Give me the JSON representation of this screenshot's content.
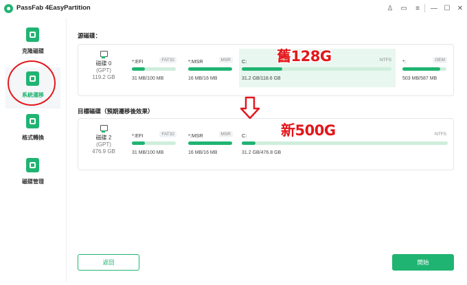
{
  "app": {
    "title": "PassFab 4EasyPartition"
  },
  "window_controls": {
    "user": "♙",
    "chat": "▭",
    "menu": "≡",
    "minimize": "—",
    "maximize": "☐",
    "close": "✕"
  },
  "sidebar": {
    "items": [
      {
        "label": "克隆磁碟",
        "icon": "clone-disk-icon"
      },
      {
        "label": "系統遷移",
        "icon": "system-migration-icon"
      },
      {
        "label": "格式轉換",
        "icon": "format-convert-icon"
      },
      {
        "label": "磁碟管理",
        "icon": "disk-management-icon"
      }
    ]
  },
  "source": {
    "label": "源磁碟：",
    "disk": {
      "name": "磁碟 0",
      "type": "(GPT)",
      "size": "119.2 GB"
    },
    "partitions": [
      {
        "name": "*:EFI",
        "fs": "FAT32",
        "size": "31 MB/100 MB",
        "fill": 0.3
      },
      {
        "name": "*:MSR",
        "fs": "MSR",
        "size": "16 MB/16 MB",
        "fill": 1.0
      },
      {
        "name": "C:",
        "fs": "NTFS",
        "size": "31.2 GB/118.6 GB",
        "fill": 0.27
      },
      {
        "name": "*:",
        "fs": "OEM",
        "size": "503 MB/587 MB",
        "fill": 0.86
      }
    ]
  },
  "target": {
    "label": "目標磁碟（預期遷移後效果）",
    "disk": {
      "name": "磁碟 2",
      "type": "(GPT)",
      "size": "476.9 GB"
    },
    "partitions": [
      {
        "name": "*:EFI",
        "fs": "FAT32",
        "size": "31 MB/100 MB",
        "fill": 0.3
      },
      {
        "name": "*:MSR",
        "fs": "MSR",
        "size": "16 MB/16 MB",
        "fill": 1.0
      },
      {
        "name": "C:",
        "fs": "NTFS",
        "size": "31.2 GB/476.8 GB",
        "fill": 0.065
      }
    ]
  },
  "annotations": {
    "old": "舊128G",
    "new": "新500G"
  },
  "buttons": {
    "back": "返回",
    "start": "開始"
  },
  "colors": {
    "accent": "#20b472",
    "annotation": "#e3171b"
  }
}
